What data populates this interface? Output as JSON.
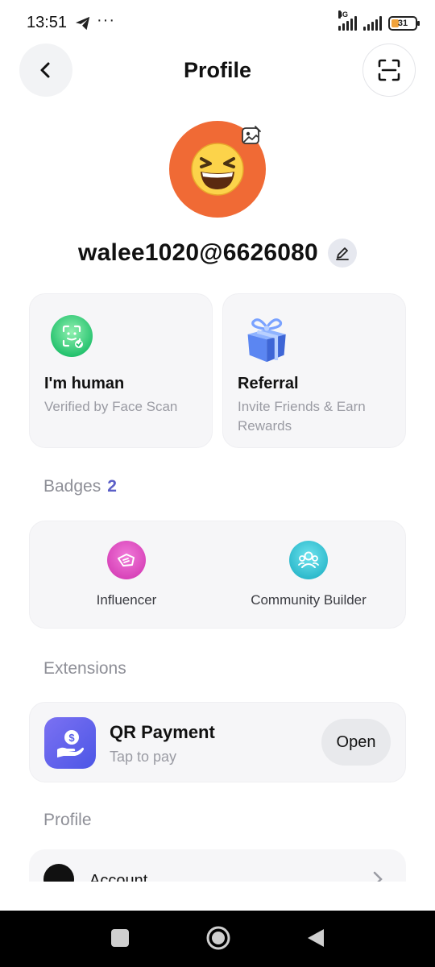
{
  "status_bar": {
    "time": "13:51",
    "network": "4G",
    "battery": "31",
    "battery_color": "#f0a23a"
  },
  "header": {
    "title": "Profile",
    "back_icon": "chevron-left-icon",
    "scan_icon": "scan-icon"
  },
  "profile": {
    "avatar_emoji": "😆",
    "avatar_color": "#f06a35",
    "username": "walee1020@6626080"
  },
  "cards": {
    "human": {
      "title": "I'm human",
      "subtitle": "Verified by Face Scan",
      "icon": "face-scan-icon"
    },
    "referral": {
      "title": "Referral",
      "subtitle": "Invite Friends & Earn Rewards",
      "icon": "gift-box-icon"
    }
  },
  "badges": {
    "title": "Badges",
    "count": "2",
    "items": [
      {
        "label": "Influencer",
        "icon": "megaphone-icon",
        "color": "#d63fb6"
      },
      {
        "label": "Community Builder",
        "icon": "community-icon",
        "color": "#1fb8c9"
      }
    ]
  },
  "extensions": {
    "title": "Extensions",
    "items": [
      {
        "title": "QR Payment",
        "subtitle": "Tap to pay",
        "action": "Open",
        "icon": "payment-hand-icon"
      }
    ]
  },
  "profile_section": {
    "title": "Profile",
    "items": [
      {
        "label": "Account",
        "icon": "account-icon"
      }
    ]
  }
}
